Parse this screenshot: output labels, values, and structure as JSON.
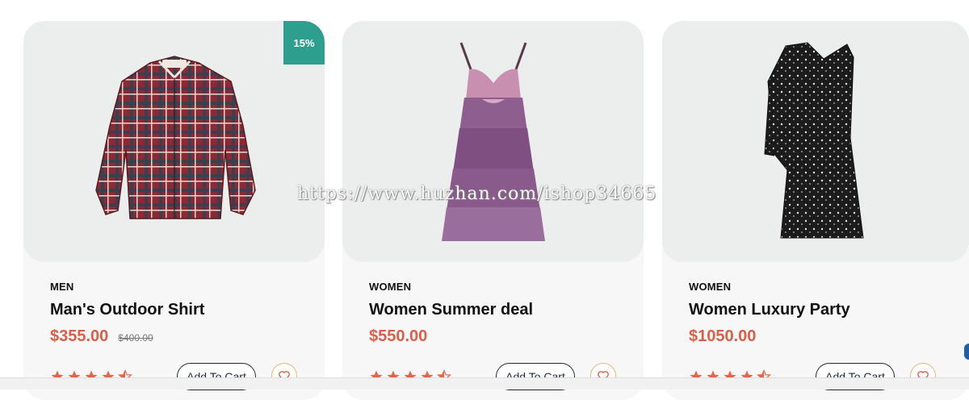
{
  "products": [
    {
      "category": "MEN",
      "title": "Man's Outdoor Shirt",
      "price": "$355.00",
      "old_price": "$400.00",
      "discount": "15%",
      "rating": 4.5,
      "cart_label": "Add To Cart"
    },
    {
      "category": "WOMEN",
      "title": "Women Summer deal",
      "price": "$550.00",
      "old_price": "",
      "discount": "",
      "rating": 4.5,
      "cart_label": "Add To Cart"
    },
    {
      "category": "WOMEN",
      "title": "Women Luxury Party",
      "price": "$1050.00",
      "old_price": "",
      "discount": "",
      "rating": 4.5,
      "cart_label": "Add To Cart"
    }
  ],
  "watermark": "https://www.huzhan.com/ishop34665",
  "colors": {
    "accent_teal": "#2e9e8f",
    "price_red": "#d8604a",
    "star_orange": "#e2664c",
    "heart_gold": "#e6b97a"
  },
  "icons": [
    "star-icon",
    "half-star-icon",
    "heart-icon"
  ]
}
